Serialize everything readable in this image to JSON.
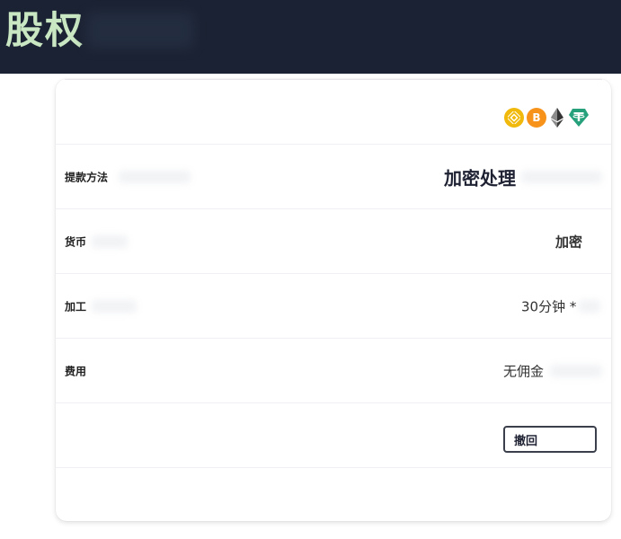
{
  "header": {
    "title": "股权"
  },
  "payment_icons": [
    "bnb-icon",
    "bitcoin-icon",
    "ethereum-icon",
    "tether-icon"
  ],
  "rows": [
    {
      "label": "提款方法",
      "value": "加密处理"
    },
    {
      "label": "货币",
      "value": "加密"
    },
    {
      "label": "加工",
      "value": "30分钟 *"
    },
    {
      "label": "费用",
      "value": "无佣金"
    }
  ],
  "actions": {
    "revoke_label": "撤回"
  },
  "colors": {
    "header_bg": "#1b2233",
    "header_text": "#c9e7c2",
    "bnb": "#f0b90b",
    "btc": "#f7931a",
    "usdt": "#26a17b"
  }
}
